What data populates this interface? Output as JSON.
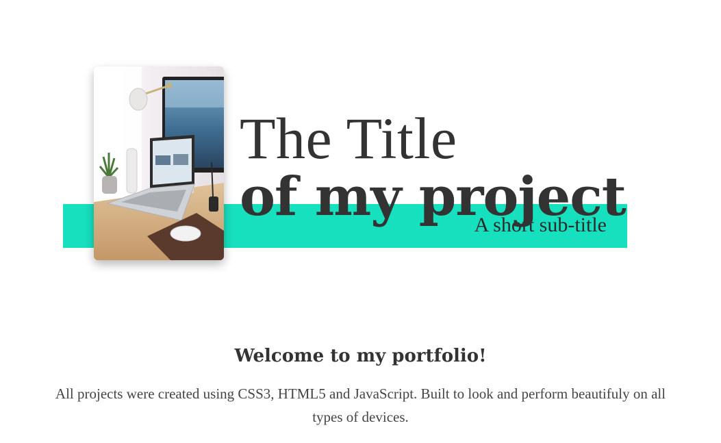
{
  "hero": {
    "title_line_1": "The Title",
    "title_line_2": "of my project",
    "subtitle": "A short sub-title",
    "accent_color": "#17e0bf",
    "image_alt": "laptop-and-monitor-on-desk-photo"
  },
  "intro": {
    "heading": "Welcome to my portfolio!",
    "body": "All projects were created using CSS3, HTML5 and JavaScript. Built to look and perform beautifuly on all types of devices."
  }
}
